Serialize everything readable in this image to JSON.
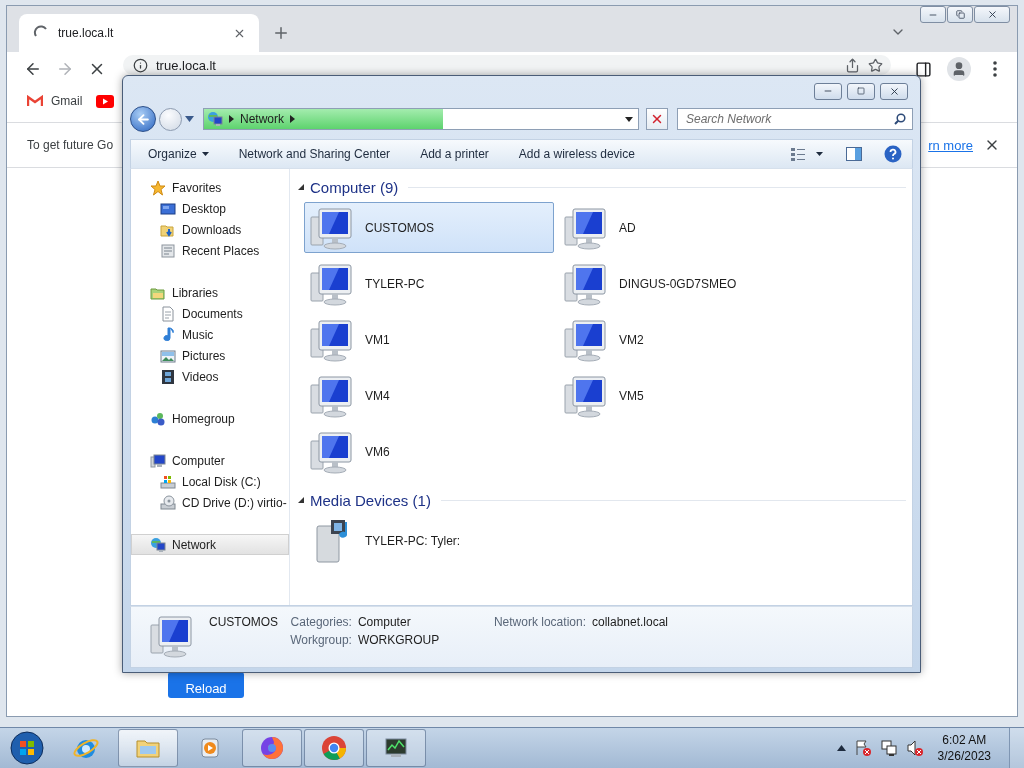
{
  "chrome": {
    "tabs": [
      {
        "title": "true.loca.lt",
        "selected": true
      }
    ],
    "address": "true.loca.lt",
    "bookmarks": [
      {
        "kind": "gmail",
        "label": "Gmail"
      },
      {
        "kind": "youtube"
      }
    ],
    "infobar": {
      "message": "To get future Go",
      "link": "rn more"
    },
    "page": {
      "button": "Reload"
    }
  },
  "explorer": {
    "address": {
      "crumbs": [
        "Network"
      ],
      "level": 0.55
    },
    "search": {
      "placeholder": "Search Network"
    },
    "commands": [
      {
        "label": "Organize",
        "menu": true
      },
      {
        "label": "Network and Sharing Center",
        "menu": false
      },
      {
        "label": "Add a printer",
        "menu": false
      },
      {
        "label": "Add a wireless device",
        "menu": false
      }
    ],
    "nav": [
      {
        "label": "Favorites",
        "kind": "star",
        "selected": false,
        "children": [
          {
            "label": "Desktop",
            "kind": "desktop",
            "selected": false
          },
          {
            "label": "Downloads",
            "kind": "downloads",
            "selected": false
          },
          {
            "label": "Recent Places",
            "kind": "recent",
            "selected": false
          }
        ]
      },
      {
        "label": "Libraries",
        "kind": "library",
        "selected": false,
        "children": [
          {
            "label": "Documents",
            "kind": "document",
            "selected": false
          },
          {
            "label": "Music",
            "kind": "music",
            "selected": false
          },
          {
            "label": "Pictures",
            "kind": "picture",
            "selected": false
          },
          {
            "label": "Videos",
            "kind": "video",
            "selected": false
          }
        ]
      },
      {
        "label": "Homegroup",
        "kind": "homegroup",
        "selected": false
      },
      {
        "label": "Computer",
        "kind": "computer",
        "selected": false,
        "children": [
          {
            "label": "Local Disk (C:)",
            "kind": "disk",
            "selected": false
          },
          {
            "label": "CD Drive (D:) virtio-",
            "kind": "cd",
            "selected": false
          }
        ]
      },
      {
        "label": "Network",
        "kind": "network",
        "selected": true
      }
    ],
    "groups": [
      {
        "title": "Computer (9)",
        "items": [
          {
            "name": "CUSTOMOS",
            "kind": "computer",
            "selected": true
          },
          {
            "name": "AD",
            "kind": "computer",
            "selected": false
          },
          {
            "name": "TYLER-PC",
            "kind": "computer",
            "selected": false
          },
          {
            "name": "DINGUS-0GD7SMEO",
            "kind": "computer",
            "selected": false
          },
          {
            "name": "VM1",
            "kind": "computer",
            "selected": false
          },
          {
            "name": "VM2",
            "kind": "computer",
            "selected": false
          },
          {
            "name": "VM4",
            "kind": "computer",
            "selected": false
          },
          {
            "name": "VM5",
            "kind": "computer",
            "selected": false
          },
          {
            "name": "VM6",
            "kind": "computer",
            "selected": false
          }
        ]
      },
      {
        "title": "Media Devices (1)",
        "items": [
          {
            "name": "TYLER-PC: Tyler:",
            "kind": "media",
            "selected": false
          }
        ]
      }
    ],
    "details": {
      "name": "CUSTOMOS",
      "fields": [
        {
          "label": "Categories:",
          "value": "Computer"
        },
        {
          "label": "Network location:",
          "value": "collabnet.local"
        },
        {
          "label": "Workgroup:",
          "value": "WORKGROUP"
        }
      ]
    }
  },
  "taskbar": {
    "apps": [
      {
        "kind": "ie",
        "running": false,
        "selected": false
      },
      {
        "kind": "folder",
        "running": true,
        "selected": true
      },
      {
        "kind": "media",
        "running": false,
        "selected": false
      },
      {
        "kind": "firefox",
        "running": true,
        "selected": false
      },
      {
        "kind": "chrome",
        "running": true,
        "selected": false
      },
      {
        "kind": "monitor",
        "running": true,
        "selected": false
      }
    ],
    "clock": {
      "time": "6:02 AM",
      "date": "3/26/2023"
    }
  }
}
